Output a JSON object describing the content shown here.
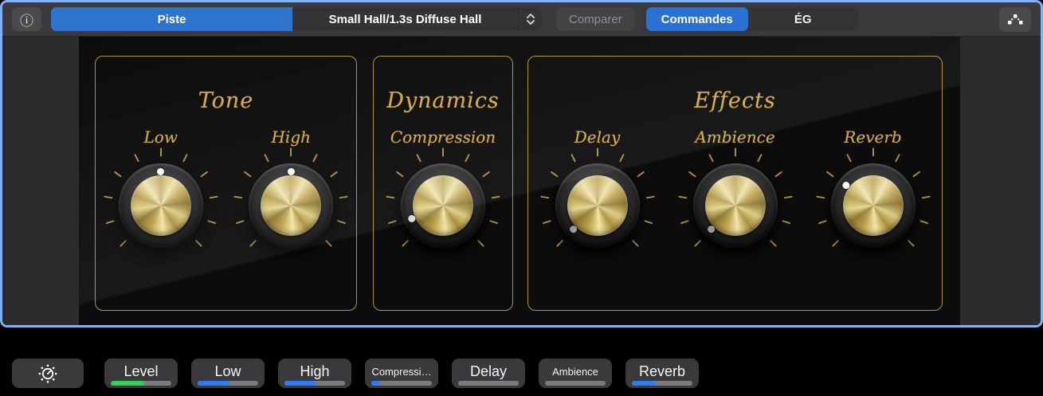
{
  "toolbar": {
    "info_icon": "info-circle",
    "track_tab_label": "Piste",
    "preset_value": "Small Hall/1.3s Diffuse Hall",
    "compare_label": "Comparer",
    "controls_tab_label": "Commandes",
    "eq_tab_label": "ÉG",
    "nodes_icon": "smart-controls-nodes",
    "accent_blue": "#2e74cd"
  },
  "panel": {
    "sections": [
      {
        "title": "Tone",
        "knobs": [
          {
            "label": "Low",
            "value_pct": 50,
            "dot_color": "#ffffff"
          },
          {
            "label": "High",
            "value_pct": 50,
            "dot_color": "#ffffff"
          }
        ]
      },
      {
        "title": "Dynamics",
        "knobs": [
          {
            "label": "Compression",
            "value_pct": 8,
            "dot_color": "#d9d9d9"
          }
        ]
      },
      {
        "title": "Effects",
        "knobs": [
          {
            "label": "Delay",
            "value_pct": 0,
            "dot_color": "#9a9a9a"
          },
          {
            "label": "Ambience",
            "value_pct": 0,
            "dot_color": "#9a9a9a"
          },
          {
            "label": "Reverb",
            "value_pct": 30,
            "dot_color": "#ffffff"
          }
        ]
      }
    ],
    "gold_border": "#b3903e",
    "gold_text": "#d5a94b"
  },
  "bottom_bar": {
    "dial_icon": "knob-dial",
    "buttons": [
      {
        "label": "Level",
        "fill_pct": 55,
        "fill_color": "#2ed158"
      },
      {
        "label": "Low",
        "fill_pct": 52,
        "fill_color": "#2e7bf5"
      },
      {
        "label": "High",
        "fill_pct": 52,
        "fill_color": "#2e7bf5"
      },
      {
        "label": "Compressi…",
        "fill_pct": 15,
        "fill_color": "#2e7bf5"
      },
      {
        "label": "Delay",
        "fill_pct": 0,
        "fill_color": "#2e7bf5"
      },
      {
        "label": "Ambience",
        "fill_pct": 0,
        "fill_color": "#2e7bf5"
      },
      {
        "label": "Reverb",
        "fill_pct": 40,
        "fill_color": "#2e7bf5"
      }
    ]
  }
}
